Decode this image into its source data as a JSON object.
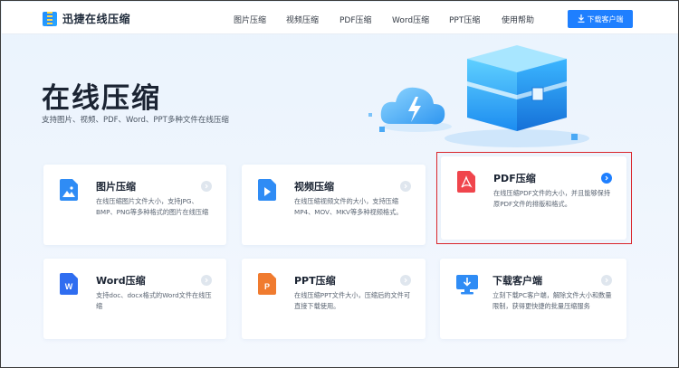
{
  "logo": {
    "text": "迅捷在线压缩"
  },
  "nav": [
    {
      "label": "图片压缩"
    },
    {
      "label": "视频压缩"
    },
    {
      "label": "PDF压缩"
    },
    {
      "label": "Word压缩"
    },
    {
      "label": "PPT压缩"
    },
    {
      "label": "使用帮助"
    }
  ],
  "header": {
    "download_label": "下载客户端"
  },
  "hero": {
    "title": "在线压缩",
    "subtitle": "支持图片、视频、PDF、Word、PPT多种文件在线压缩"
  },
  "cards": [
    {
      "title": "图片压缩",
      "desc": "在线压缩图片文件大小，支持JPG、BMP、PNG等多种格式的图片在线压缩",
      "icon": "image-file-icon",
      "color": "#2f8cf5"
    },
    {
      "title": "视频压缩",
      "desc": "在线压缩视频文件的大小，支持压缩MP4、MOV、MKV等多种视频格式。",
      "icon": "video-file-icon",
      "color": "#2f8cf5"
    },
    {
      "title": "PDF压缩",
      "desc": "在线压缩PDF文件的大小，并且能够保持原PDF文件的排版和格式。",
      "icon": "pdf-file-icon",
      "color": "#f0454c",
      "active": true
    },
    {
      "title": "Word压缩",
      "desc": "支持doc、docx格式的Word文件在线压缩",
      "icon": "word-file-icon",
      "color": "#2f6df0"
    },
    {
      "title": "PPT压缩",
      "desc": "在线压缩PPT文件大小，压缩后的文件可直接下载使用。",
      "icon": "ppt-file-icon",
      "color": "#f07b2f"
    },
    {
      "title": "下载客户端",
      "desc": "立刻下载PC客户端，解除文件大小和数量限制，获得更快捷的批量压缩服务",
      "icon": "monitor-download-icon",
      "color": "#2f8cf5"
    }
  ]
}
